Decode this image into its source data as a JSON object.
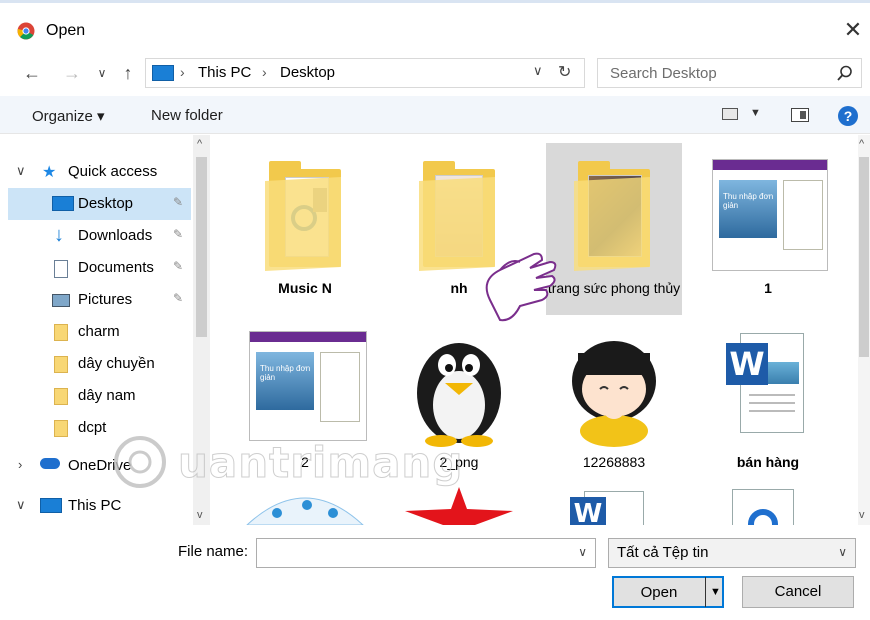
{
  "window": {
    "title": "Open",
    "close_glyph": "✕"
  },
  "nav": {
    "back_glyph": "←",
    "forward_glyph": "→",
    "recent_glyph": "∨",
    "up_glyph": "↑",
    "breadcrumb": [
      "This PC",
      "Desktop"
    ],
    "separator": "›",
    "dropdown_glyph": "∨",
    "refresh_glyph": "↻",
    "search_placeholder": "Search Desktop"
  },
  "toolbar": {
    "organize_label": "Organize ▾",
    "new_folder_label": "New folder",
    "view_dd": "▼",
    "help_glyph": "?"
  },
  "sidebar": {
    "expand_glyph": "∨",
    "collapsed_glyph": "›",
    "pin_glyph": "✎",
    "quick_access": "Quick access",
    "items": [
      {
        "label": "Desktop",
        "icon": "desktop-icon",
        "pinned": true,
        "selected": true
      },
      {
        "label": "Downloads",
        "icon": "download-icon",
        "pinned": true
      },
      {
        "label": "Documents",
        "icon": "documents-icon",
        "pinned": true
      },
      {
        "label": "Pictures",
        "icon": "pictures-icon",
        "pinned": true
      },
      {
        "label": "charm",
        "icon": "folder-icon"
      },
      {
        "label": "dây chuyền",
        "icon": "folder-icon"
      },
      {
        "label": "dây nam",
        "icon": "folder-icon"
      },
      {
        "label": "dcpt",
        "icon": "folder-icon"
      }
    ],
    "onedrive": "OneDrive",
    "this_pc": "This PC"
  },
  "files": [
    {
      "name": "Music N",
      "kind": "folder"
    },
    {
      "name": "nh",
      "kind": "folder"
    },
    {
      "name": "trang sức phong thủy",
      "kind": "folder",
      "selected": true
    },
    {
      "name": "1",
      "kind": "image"
    },
    {
      "name": "2",
      "kind": "image"
    },
    {
      "name": "2_png",
      "kind": "image"
    },
    {
      "name": "12268883",
      "kind": "image"
    },
    {
      "name": "bán hàng",
      "kind": "word-document"
    }
  ],
  "thumb_text": {
    "web_heading": "Thu nhập đơn giản",
    "word_letter": "W"
  },
  "footer": {
    "file_name_label": "File name:",
    "file_name_value": "",
    "file_type_value": "Tất cả Tệp tin",
    "open_label": "Open",
    "cancel_label": "Cancel",
    "dropdown_glyph": "∨"
  },
  "scroll": {
    "up": "^",
    "down": "v"
  },
  "watermark": "uantrimang",
  "colors": {
    "accent": "#0078d7",
    "selection": "#cce4f7",
    "folder": "#f2c94c",
    "toolbar_bg": "#f2f6fb"
  }
}
